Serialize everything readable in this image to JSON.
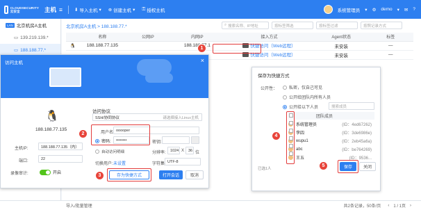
{
  "topbar": {
    "logo_text": "CLOUDSECURITY 云安全",
    "title": "主机",
    "nav": [
      "导入主机",
      "创建主机",
      "授权主机"
    ],
    "user": "系统管理员",
    "env": "demo"
  },
  "sidebar": {
    "group_badge": "LAN",
    "group": "北京机房A主机",
    "items": [
      "139.219.139.*",
      "188.188.77.*"
    ]
  },
  "main": {
    "breadcrumb": "北京机房A主机  >  188.188.77.*",
    "search_placeholder": "搜索名称、IP地址",
    "filter1": "按标签筛选",
    "filter2": "按标签过滤",
    "filter3": "按照记录方式",
    "columns": [
      "名称",
      "公网IP",
      "内网IP",
      "接入方式",
      "Agent状态",
      "标签"
    ],
    "rows": [
      {
        "name": "188.188.77.135",
        "public_ip": "",
        "private_ip": "188.188.77.1",
        "access": "快捷访问（Web远程）",
        "agent": "未安装",
        "tag": "—"
      },
      {
        "name": "",
        "public_ip": "",
        "private_ip": "",
        "access": "快捷访问（Web远程）",
        "agent": "未安装",
        "tag": "—"
      }
    ]
  },
  "footer": {
    "left": "导入/批量管理",
    "total": "共2条记录，50条/页",
    "page": "1 / 1页"
  },
  "dialog": {
    "title": "访问主机",
    "host_name": "188.188.77.135",
    "host_ip_label": "主机IP:",
    "host_ip": "188.188.77.135（内）",
    "port_label": "端口:",
    "port": "22",
    "record_label": "录像审计:",
    "record_value": "开启",
    "protocol_title": "访问协议",
    "protocol": "SSH/协同协议",
    "protocol_hint": "请选择接入Linux主机",
    "user_label": "用户名:",
    "user_value": "ooooper",
    "pw_label": "密码:",
    "pw_value": "••••••••",
    "secret_label": "密钥:",
    "opt1": "自动访问明细",
    "resolution_label": "分辨率:",
    "res_w": "1024",
    "res_x": "X",
    "res_h": "36",
    "res_extra": "位",
    "switch_user_label": "切换用户:",
    "switch_user_value": "未设置",
    "charset_label": "字符集:",
    "charset_value": "UTF-8",
    "btn_save": "存为快捷方式",
    "btn_open": "打开会话",
    "btn_cancel": "取消"
  },
  "popup": {
    "title": "保存为快捷方式",
    "public_label": "公开性：",
    "options": [
      "私密，仅自己可见",
      "公开给团队内所有人员",
      "公开给以下人员"
    ],
    "search_placeholder": "搜索成员",
    "header": "团队成员",
    "members": [
      {
        "name": "系统管理员",
        "id": "(ID：4ed67262)"
      },
      {
        "name": "李四",
        "id": "(ID：3de6986e)"
      },
      {
        "name": "wupu1",
        "id": "(ID：2eb45a6a)"
      },
      {
        "name": "abc",
        "id": "(ID：be764269)"
      },
      {
        "name": "王五",
        "id": "(ID：9536..."
      }
    ],
    "selected": "已选1人",
    "btn_save": "保存",
    "btn_close": "关闭"
  },
  "callouts": [
    "1",
    "2",
    "3",
    "4",
    "5"
  ]
}
